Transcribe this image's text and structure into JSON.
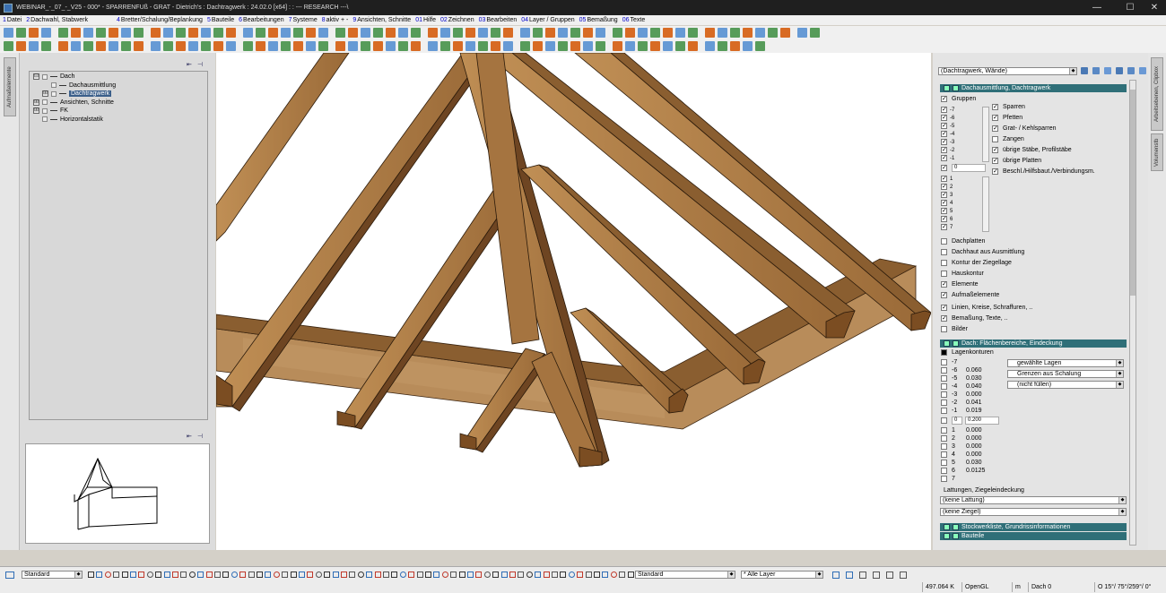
{
  "window": {
    "title": "WEBINAR_-_07_-_V25 - 000* - SPARRENFUß - GRAT - Dietrich's : Dachtragwerk : 24.02.0 [x64] : : --- RESEARCH ---\\",
    "controls": [
      "—",
      "☐",
      "✕"
    ]
  },
  "menu": [
    {
      "num": "1",
      "label": "Datei"
    },
    {
      "num": "2",
      "label": "Dachwahl, Stabwerk"
    },
    {
      "num": "4",
      "label": "Bretter/Schalung/Beplankung"
    },
    {
      "num": "5",
      "label": "Bauteile"
    },
    {
      "num": "6",
      "label": "Bearbeitungen"
    },
    {
      "num": "7",
      "label": "Systeme"
    },
    {
      "num": "8",
      "label": "aktiv + -"
    },
    {
      "num": "9",
      "label": "Ansichten, Schnitte"
    },
    {
      "num": "01",
      "label": "Hilfe"
    },
    {
      "num": "02",
      "label": "Zeichnen"
    },
    {
      "num": "03",
      "label": "Bearbeiten"
    },
    {
      "num": "04",
      "label": "Layer / Gruppen"
    },
    {
      "num": "05",
      "label": "Bemaßung"
    },
    {
      "num": "06",
      "label": "Texte"
    }
  ],
  "left_strip": {
    "tab": "Aufmaßelemente"
  },
  "tree": {
    "items": [
      {
        "label": "Dach",
        "level": 0,
        "expander": "⊟"
      },
      {
        "label": "Dachausmittlung",
        "level": 1,
        "expander": ""
      },
      {
        "label": "Dachtragwerk",
        "level": 1,
        "expander": "⊞",
        "selected": true
      },
      {
        "label": "Ansichten, Schnitte",
        "level": 0,
        "expander": "⊞"
      },
      {
        "label": "FK",
        "level": 0,
        "expander": "⊞"
      },
      {
        "label": "Horizontalstatik",
        "level": 0,
        "expander": ""
      }
    ]
  },
  "right_panel": {
    "combo": "(Dachtragwerk, Wände)",
    "section1": "Dachausmittlung, Dachtragwerk",
    "gruppen_label": "Gruppen",
    "neg_groups": [
      "-7",
      "-6",
      "-5",
      "-4",
      "-3",
      "-2",
      "-1"
    ],
    "zero_group": "0",
    "pos_groups": [
      "1",
      "2",
      "3",
      "4",
      "5",
      "6",
      "7"
    ],
    "element_checks": [
      {
        "label": "Sparren",
        "on": true
      },
      {
        "label": "Pfetten",
        "on": true
      },
      {
        "label": "Grat- / Kehlsparren",
        "on": true
      },
      {
        "label": "Zangen",
        "on": false
      },
      {
        "label": "übrige Stäbe, Profilstäbe",
        "on": true
      },
      {
        "label": "übrige Platten",
        "on": true
      },
      {
        "label": "Beschl./Hilfsbaut./Verbindungsm.",
        "on": true
      }
    ],
    "options": [
      {
        "label": "Dachplatten",
        "on": false
      },
      {
        "label": "Dachhaut aus Ausmittlung",
        "on": false
      },
      {
        "label": "Kontur der Ziegellage",
        "on": false
      },
      {
        "label": "Hauskontur",
        "on": false
      },
      {
        "label": "Elemente",
        "on": true
      },
      {
        "label": "Aufmaßelemente",
        "on": true
      }
    ],
    "options2": [
      {
        "label": "Linien, Kreise, Schraffuren, ..",
        "on": true
      },
      {
        "label": "Bemaßung, Texte, ..",
        "on": true
      },
      {
        "label": "Bilder",
        "on": false
      }
    ],
    "section2": "Dach: Flächenbereiche, Eindeckung",
    "lagenkonturen": "Lagenkonturen",
    "neg_vals": [
      {
        "g": "-7",
        "v": ""
      },
      {
        "g": "-6",
        "v": "0.060"
      },
      {
        "g": "-5",
        "v": "0.030"
      },
      {
        "g": "-4",
        "v": "0.040"
      },
      {
        "g": "-3",
        "v": "0.000"
      },
      {
        "g": "-2",
        "v": "0.041"
      },
      {
        "g": "-1",
        "v": "0.019"
      }
    ],
    "zero_val": {
      "g": "0",
      "v": "0.200"
    },
    "pos_vals": [
      {
        "g": "1",
        "v": "0.000"
      },
      {
        "g": "2",
        "v": "0.000"
      },
      {
        "g": "3",
        "v": "0.000"
      },
      {
        "g": "4",
        "v": "0.000"
      },
      {
        "g": "5",
        "v": "0.030"
      },
      {
        "g": "6",
        "v": "0.0125"
      },
      {
        "g": "7",
        "v": ""
      }
    ],
    "combos": [
      "gewählte Lagen",
      "Grenzen aus Schalung",
      "(nicht füllen)"
    ],
    "lattung_label": "Lattungen, Ziegeleindeckung",
    "lattung_combo": "(keine Lattung)",
    "ziegel_combo": "(keine Ziegel)",
    "section3": "Stockwerkliste, Grundrissinformationen",
    "section4": "Bauteile"
  },
  "right_strip": {
    "tabs": [
      "Arbeitsebenen, Clipbox",
      "Volumenstb"
    ]
  },
  "bottom": {
    "combo1": "Standard",
    "combo2": "Standard",
    "combo3": "* Alle Layer"
  },
  "status": {
    "mem": "497.064 K",
    "renderer": "OpenGL",
    "unit": "m",
    "layer": "Dach 0",
    "angle": "O 15°/ 75°/259°/  0°"
  },
  "colors": {
    "wood_light": "#b8864e",
    "wood_mid": "#9a6a38",
    "wood_dark": "#6e4522",
    "header_teal": "#2f6f78"
  }
}
